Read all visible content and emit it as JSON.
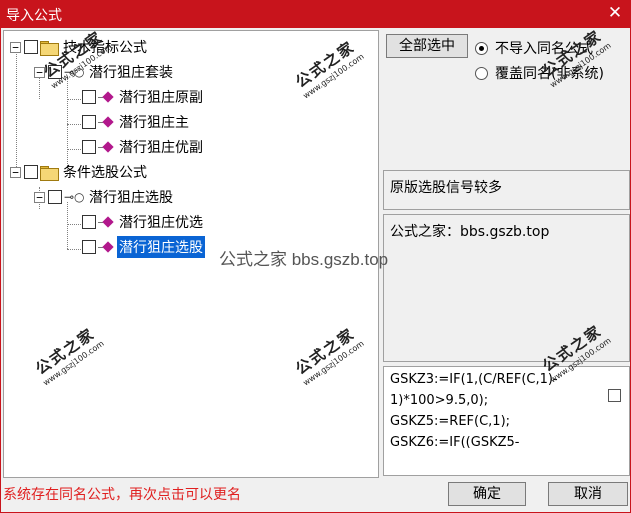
{
  "window": {
    "title": "导入公式"
  },
  "tree": {
    "nodes": [
      {
        "label": "技术指标公式"
      },
      {
        "label": "潜行狙庄套装"
      },
      {
        "label": "潜行狙庄原副"
      },
      {
        "label": "潜行狙庄主"
      },
      {
        "label": "潜行狙庄优副"
      },
      {
        "label": "条件选股公式"
      },
      {
        "label": "潜行狙庄选股"
      },
      {
        "label": "潜行狙庄优选"
      },
      {
        "label": "潜行狙庄选股",
        "selected": true
      }
    ]
  },
  "buttons": {
    "select_all": "全部选中",
    "ok": "确定",
    "cancel": "取消"
  },
  "options": {
    "no_import_same": "不导入同名公式",
    "overwrite_same": "覆盖同名(非系统)",
    "selected": "no_import_same"
  },
  "panels": {
    "description": "原版选股信号较多",
    "source": "公式之家：bbs.gszb.top",
    "code": "GSKZ3:=IF(1,(C/REF(C,1)-\n1)*100>9.5,0);\nGSKZ5:=REF(C,1);\nGSKZ6:=IF((GSKZ5-"
  },
  "status": {
    "message": "系统存在同名公式，再次点击可以更名"
  },
  "watermark": {
    "overlay": "公式之家 bbs.gszb.top",
    "stamp_big": "公式之家",
    "stamp_small": "www.gszj100.com"
  },
  "colors": {
    "titlebar": "#c8141c",
    "selection": "#0a64d4",
    "status_text": "#e02020"
  }
}
